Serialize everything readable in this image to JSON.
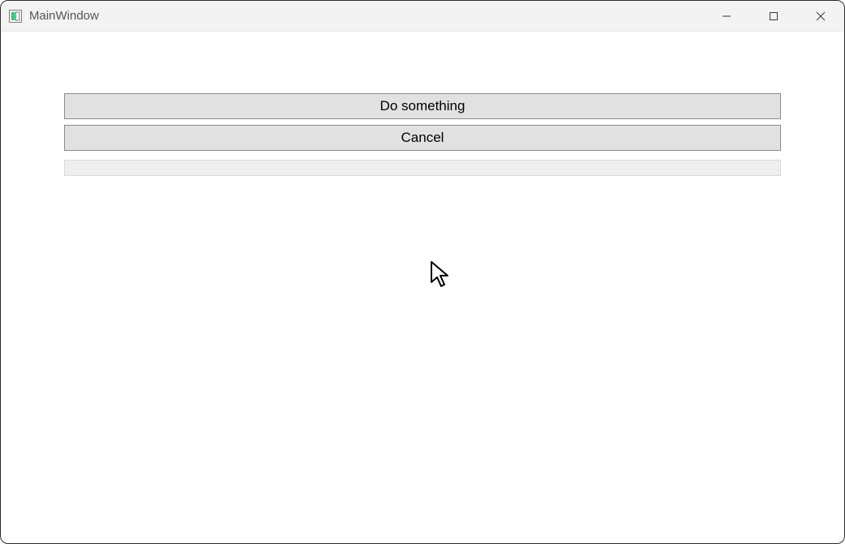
{
  "window": {
    "title": "MainWindow"
  },
  "buttons": {
    "primary_label": "Do something",
    "cancel_label": "Cancel"
  },
  "progress": {
    "percent": 0
  }
}
